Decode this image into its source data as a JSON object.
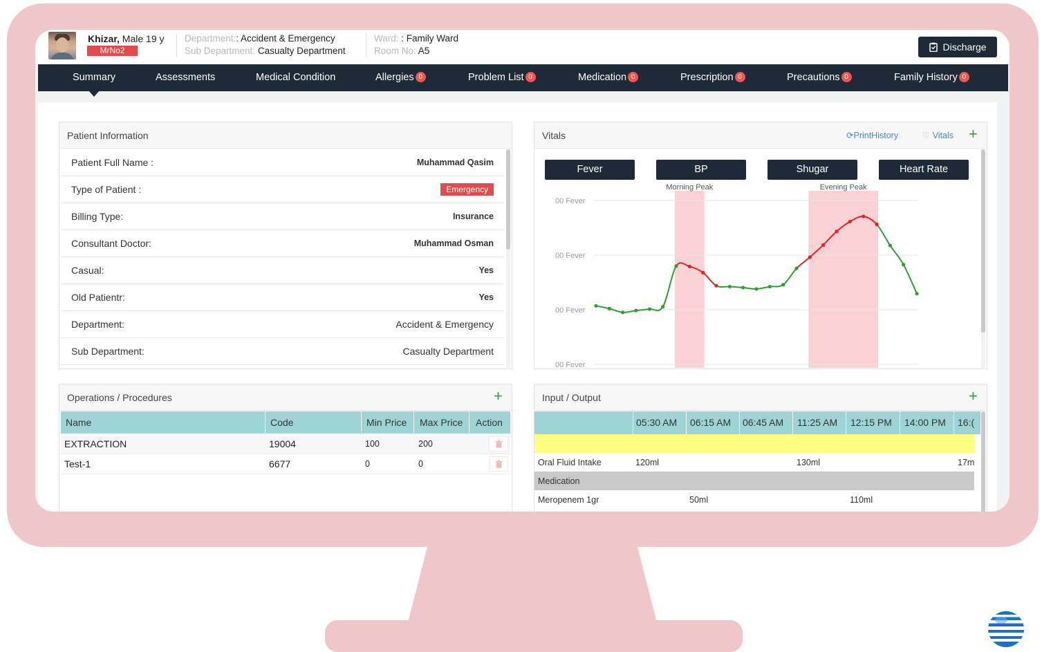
{
  "patient": {
    "name": "Khizar,",
    "gender_age": " Male 19 y",
    "mrno": "MrNo2",
    "department_label": "Department:",
    "department_value": ": Accident & Emergency",
    "sub_department_label": "Sub Department:",
    "sub_department_value": " Casualty Department",
    "ward_label": "Ward:",
    "ward_value": " : Family Ward",
    "room_label": "Room No:",
    "room_value": " A5"
  },
  "actions": {
    "discharge_label": "Discharge"
  },
  "nav": {
    "items": [
      {
        "label": "Summary",
        "badge": ""
      },
      {
        "label": "Assessments",
        "badge": ""
      },
      {
        "label": "Medical Condition",
        "badge": ""
      },
      {
        "label": "Allergies",
        "badge": "0"
      },
      {
        "label": "Problem List",
        "badge": "0"
      },
      {
        "label": "Medication",
        "badge": "0"
      },
      {
        "label": "Prescription",
        "badge": "0"
      },
      {
        "label": "Precautions",
        "badge": "0"
      },
      {
        "label": "Family History",
        "badge": "0"
      }
    ],
    "active": "Summary"
  },
  "patient_info": {
    "title": "Patient Information",
    "rows": [
      {
        "label": "Patient Full Name :",
        "value": "Muhammad Qasim"
      },
      {
        "label": "Type of Patient :",
        "value": "Emergency"
      },
      {
        "label": "Billing Type:",
        "value": "Insurance"
      },
      {
        "label": "Consultant Doctor:",
        "value": "Muhammad Osman"
      },
      {
        "label": "Casual:",
        "value": "Yes"
      },
      {
        "label": "Old Patientr:",
        "value": "Yes"
      },
      {
        "label": "Department:",
        "value": "Accident & Emergency"
      },
      {
        "label": "Sub Department:",
        "value": "Casualty Department"
      }
    ]
  },
  "operations": {
    "title": "Operations / Procedures",
    "columns": [
      "Name",
      "Code",
      "Min Price",
      "Max Price",
      "Action"
    ],
    "rows": [
      {
        "name": "EXTRACTION",
        "code": "19004",
        "min": "100",
        "max": "200"
      },
      {
        "name": "Test-1",
        "code": "6677",
        "min": "0",
        "max": "0"
      }
    ]
  },
  "vitals": {
    "title": "Vitals",
    "print_history": "PrintHistory",
    "vitals_link": "Vitals",
    "buttons": [
      "Fever",
      "BP",
      "Shugar",
      "Heart Rate"
    ]
  },
  "chart_data": {
    "type": "line",
    "title": "",
    "y_tick_labels": [
      "00 Fever",
      "00 Fever",
      "00 Fever",
      "00 Fever"
    ],
    "y": [
      -0.3,
      -0.42,
      -0.58,
      -0.5,
      -0.44,
      -0.34,
      1.4,
      1.38,
      1.12,
      0.56,
      0.52,
      0.48,
      0.42,
      0.52,
      0.6,
      1.3,
      1.78,
      2.3,
      2.88,
      3.3,
      3.52,
      3.18,
      2.28,
      1.46,
      0.22
    ],
    "segment_colors": [
      "green",
      "green",
      "green",
      "green",
      "green",
      "green",
      "red",
      "red",
      "red",
      "green",
      "green",
      "green",
      "green",
      "green",
      "green",
      "red",
      "red",
      "red",
      "red",
      "red",
      "red",
      "green",
      "green",
      "green"
    ],
    "peaks": [
      {
        "label": "Morning Peak",
        "from_index": 6,
        "to_index": 8
      },
      {
        "label": "Evening Peak",
        "from_index": 16,
        "to_index": 21
      }
    ],
    "ylim": [
      -1,
      4.2
    ],
    "grid": true,
    "colors": {
      "normal": "#2f9e2f",
      "peak": "#e02424",
      "band": "#f9c9cc"
    }
  },
  "io": {
    "title": "Input / Output",
    "times": [
      "05:30 AM",
      "06:15 AM",
      "06:45 AM",
      "11:25 AM",
      "12:15 PM",
      "14:00 PM",
      "16:("
    ],
    "rows": [
      {
        "label": "Oral Fluid Intake",
        "values": [
          "120ml",
          "130ml",
          "17m"
        ]
      },
      {
        "section": "Medication"
      },
      {
        "label": "Meropenem 1gr",
        "values": [
          "50ml",
          "110ml"
        ]
      }
    ]
  }
}
